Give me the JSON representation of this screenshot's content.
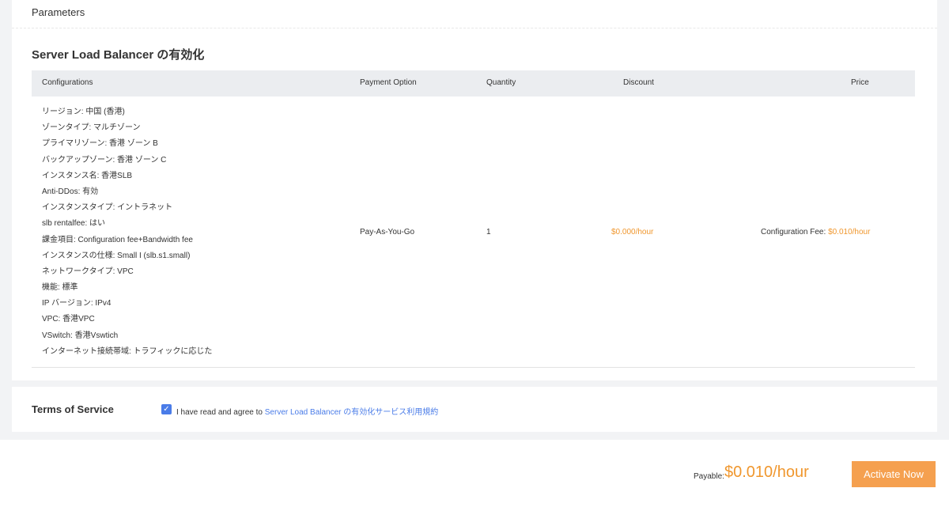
{
  "parameters": {
    "title": "Parameters"
  },
  "section": {
    "title": "Server Load Balancer の有効化"
  },
  "table": {
    "headers": {
      "configurations": "Configurations",
      "payment_option": "Payment Option",
      "quantity": "Quantity",
      "discount": "Discount",
      "price": "Price"
    },
    "configurations": [
      "リージョン: 中国 (香港)",
      "ゾーンタイプ: マルチゾーン",
      "プライマリゾーン: 香港 ゾーン B",
      "バックアップゾーン: 香港 ゾーン C",
      "インスタンス名: 香港SLB",
      "Anti-DDos: 有効",
      "インスタンスタイプ: イントラネット",
      "slb rentalfee: はい",
      "課金項目: Configuration fee+Bandwidth fee",
      "インスタンスの仕様: Small I (slb.s1.small)",
      "ネットワークタイプ: VPC",
      "機能: 標準",
      "IP バージョン: IPv4",
      "VPC: 香港VPC",
      "VSwitch: 香港Vswtich",
      "インターネット接続帯域: トラフィックに応じた"
    ],
    "payment_option": "Pay-As-You-Go",
    "quantity": "1",
    "discount": "$0.000/hour",
    "price_label": "Configuration Fee:",
    "price_value": "$0.010/hour"
  },
  "terms": {
    "title": "Terms of Service",
    "checked": true,
    "check_glyph": "✓",
    "text": "I have read and agree to",
    "link": "Server Load Balancer の有効化サービス利用規約"
  },
  "footer": {
    "payable_label": "Payable:",
    "payable_value": "$0.010/hour",
    "activate_label": "Activate Now"
  },
  "colors": {
    "accent_orange": "#f0972e",
    "button_orange": "#f5a04f",
    "link_blue": "#4a7ce8",
    "header_gray": "#ebedf0"
  }
}
